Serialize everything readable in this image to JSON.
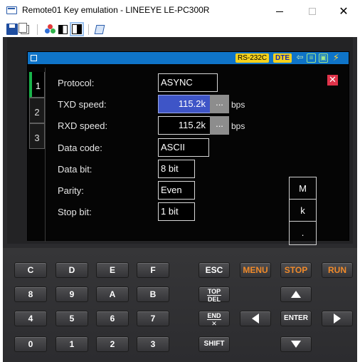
{
  "window": {
    "title": "Remote01 Key emulation - LINEEYE LE-PC300R",
    "minimize": "–",
    "close": "✕"
  },
  "toolbar": {
    "icons": [
      "save-icon",
      "copy-icon",
      "color-icon",
      "invert-icon",
      "invert-active-icon",
      "manual-icon"
    ]
  },
  "status": {
    "interface": "RS-232C",
    "mode": "DTE",
    "arrow": "⇦",
    "lines": "≡",
    "box": "▣",
    "bolt": "⚡"
  },
  "tabs": [
    "1",
    "2",
    "3"
  ],
  "settings": {
    "protocol_label": "Protocol:",
    "protocol_value": "ASYNC",
    "txd_label": "TXD speed:",
    "txd_value": "115.2k",
    "rxd_label": "RXD speed:",
    "rxd_value": "115.2k",
    "ellipsis": "...",
    "unit": "bps",
    "datacode_label": "Data code:",
    "datacode_value": "ASCII",
    "databit_label": "Data bit:",
    "databit_value": "8 bit",
    "parity_label": "Parity:",
    "parity_value": "Even",
    "stopbit_label": "Stop bit:",
    "stopbit_value": "1 bit",
    "close": "✕"
  },
  "side_keys": [
    "M",
    "k",
    "."
  ],
  "keypad": {
    "row1": [
      "C",
      "D",
      "E",
      "F"
    ],
    "row2": [
      "8",
      "9",
      "A",
      "B"
    ],
    "row3": [
      "4",
      "5",
      "6",
      "7"
    ],
    "row4": [
      "0",
      "1",
      "2",
      "3"
    ],
    "esc": "ESC",
    "menu": "MENU",
    "stop": "STOP",
    "run": "RUN",
    "top": "TOP",
    "del": "DEL",
    "end": "END",
    "x": "✕",
    "shift": "SHIFT",
    "enter": "ENTER"
  },
  "colors": {
    "status_bar": "#0f74c8",
    "selected_field": "#3e55c7",
    "accent_orange": "#f08a2a",
    "tab_active": "#18b34a"
  }
}
